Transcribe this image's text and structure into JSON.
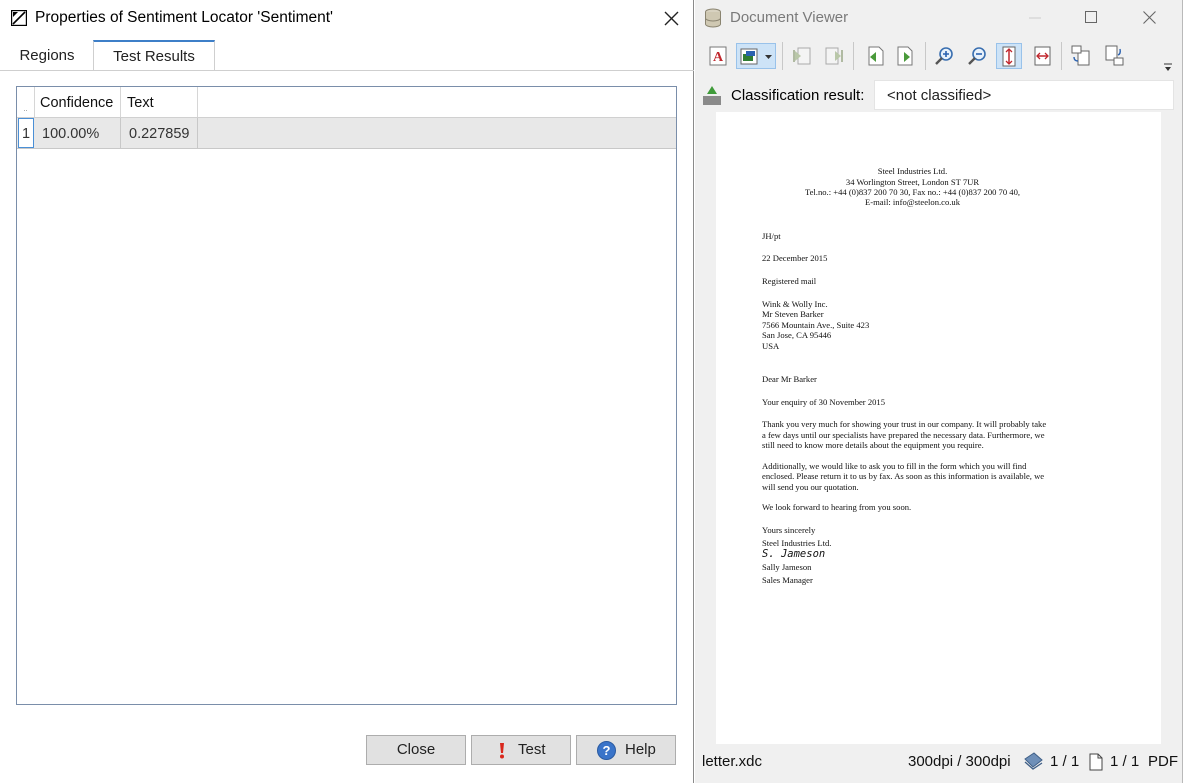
{
  "dialog": {
    "title": "Properties of Sentiment Locator 'Sentiment'",
    "tabs": [
      {
        "label": "Regions"
      },
      {
        "label": "Test Results"
      }
    ],
    "grid": {
      "columns": [
        "Confidence",
        "Text"
      ],
      "rows": [
        {
          "index": "1",
          "confidence": "100.00%",
          "text": "0.227859"
        }
      ]
    },
    "buttons": {
      "close": "Close",
      "test": "Test",
      "help": "Help"
    }
  },
  "viewer": {
    "title": "Document Viewer",
    "classification_label": "Classification result:",
    "classification_value": "<not classified>",
    "letter": {
      "header": [
        "Steel Industries Ltd.",
        "34 Worlington Street, London ST 7UR",
        "Tel.no.: +44 (0)837 200 70 30, Fax no.: +44 (0)837 200 70 40,",
        "E-mail: info@steelon.co.uk"
      ],
      "ref": "JH/pt",
      "date": "22 December 2015",
      "mail_type": "Registered mail",
      "address": [
        "Wink & Wolly Inc.",
        "Mr Steven Barker",
        "7566 Mountain Ave., Suite 423",
        "San Jose, CA 95446",
        "USA"
      ],
      "salutation": "Dear Mr Barker",
      "subject": "Your enquiry of 30 November 2015",
      "para1": [
        "Thank you very much for showing your trust in our company. It will probably take",
        "a few days until our specialists have prepared the necessary data. Furthermore, we",
        "still need to know more details about the equipment you require."
      ],
      "para2": [
        "Additionally, we would like to ask you to fill in the form which you will find",
        "enclosed. Please return it to us by fax. As soon as this information is available, we",
        "will send you our quotation."
      ],
      "closing_line": "We look forward to hearing from you soon.",
      "closing": "Yours sincerely",
      "company": "Steel Industries Ltd.",
      "signature": "S. Jameson",
      "signer": "Sally Jameson",
      "role": "Sales Manager"
    },
    "status": {
      "filename": "letter.xdc",
      "dpi": "300dpi / 300dpi",
      "pages_a": "1 / 1",
      "pages_b": "1 / 1",
      "format": "PDF"
    }
  },
  "colors": {
    "accent": "#3e7fc8",
    "grid_border": "#7a8eaa",
    "row_bg": "#e8e8e8"
  }
}
